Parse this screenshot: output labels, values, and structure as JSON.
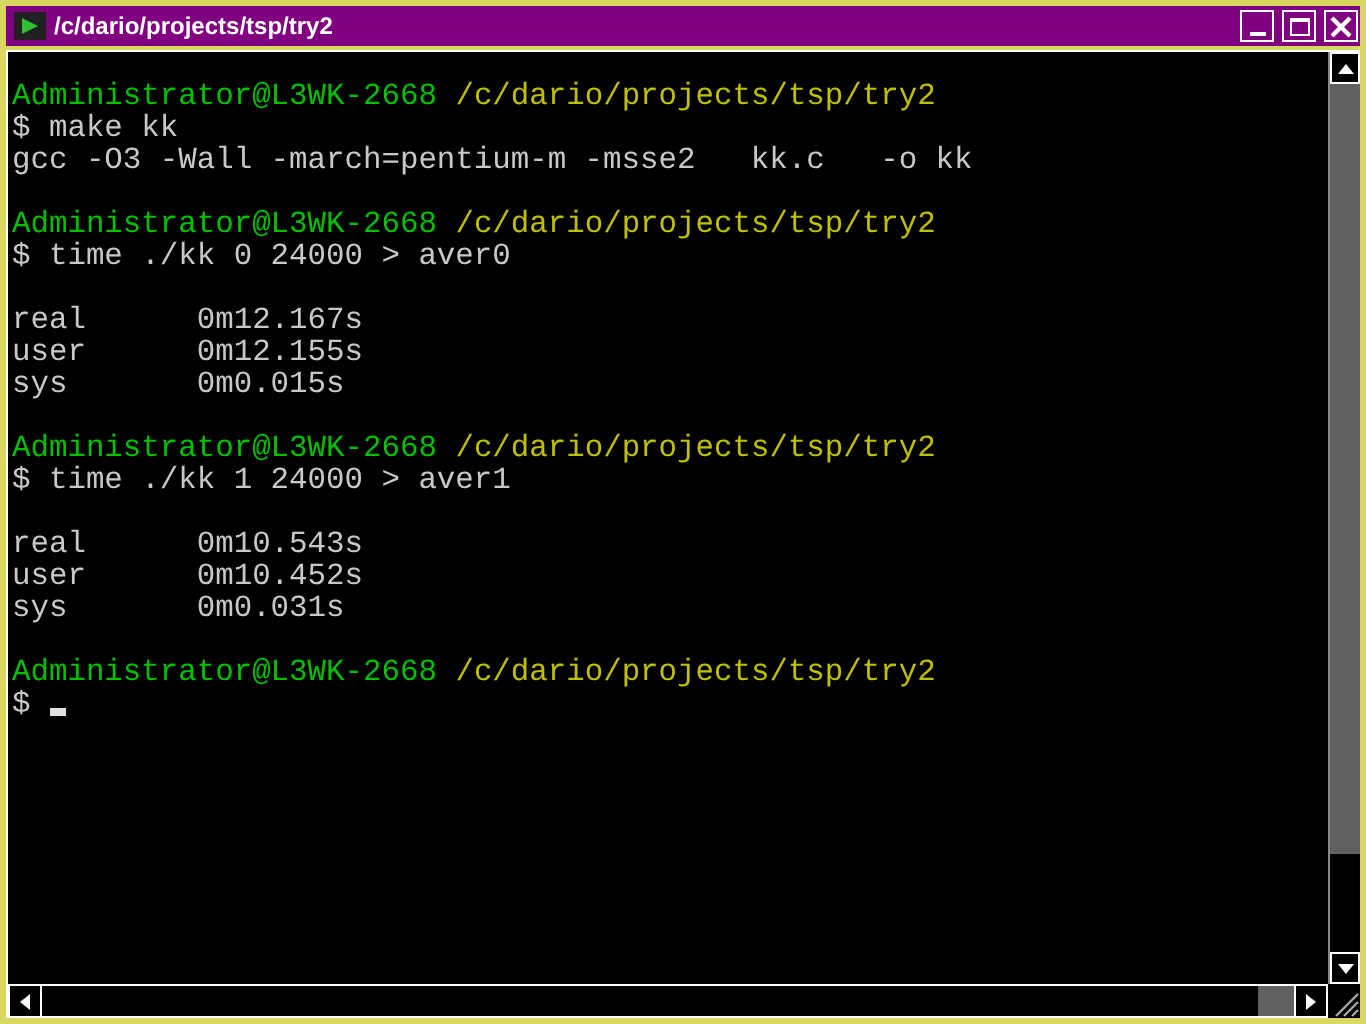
{
  "window": {
    "title": "/c/dario/projects/tsp/try2"
  },
  "terminal": {
    "lines": [
      {
        "kind": "prompt",
        "user_host": "Administrator@L3WK-2668",
        "path": "/c/dario/projects/tsp/try2"
      },
      {
        "kind": "input",
        "text": "$ make kk"
      },
      {
        "kind": "output",
        "text": "gcc -O3 -Wall -march=pentium-m -msse2   kk.c   -o kk"
      },
      {
        "kind": "blank"
      },
      {
        "kind": "prompt",
        "user_host": "Administrator@L3WK-2668",
        "path": "/c/dario/projects/tsp/try2"
      },
      {
        "kind": "input",
        "text": "$ time ./kk 0 24000 > aver0"
      },
      {
        "kind": "blank"
      },
      {
        "kind": "output",
        "text": "real      0m12.167s"
      },
      {
        "kind": "output",
        "text": "user      0m12.155s"
      },
      {
        "kind": "output",
        "text": "sys       0m0.015s"
      },
      {
        "kind": "blank"
      },
      {
        "kind": "prompt",
        "user_host": "Administrator@L3WK-2668",
        "path": "/c/dario/projects/tsp/try2"
      },
      {
        "kind": "input",
        "text": "$ time ./kk 1 24000 > aver1"
      },
      {
        "kind": "blank"
      },
      {
        "kind": "output",
        "text": "real      0m10.543s"
      },
      {
        "kind": "output",
        "text": "user      0m10.452s"
      },
      {
        "kind": "output",
        "text": "sys       0m0.031s"
      },
      {
        "kind": "blank"
      },
      {
        "kind": "prompt",
        "user_host": "Administrator@L3WK-2668",
        "path": "/c/dario/projects/tsp/try2"
      },
      {
        "kind": "input",
        "text": "$",
        "cursor": true
      }
    ]
  }
}
